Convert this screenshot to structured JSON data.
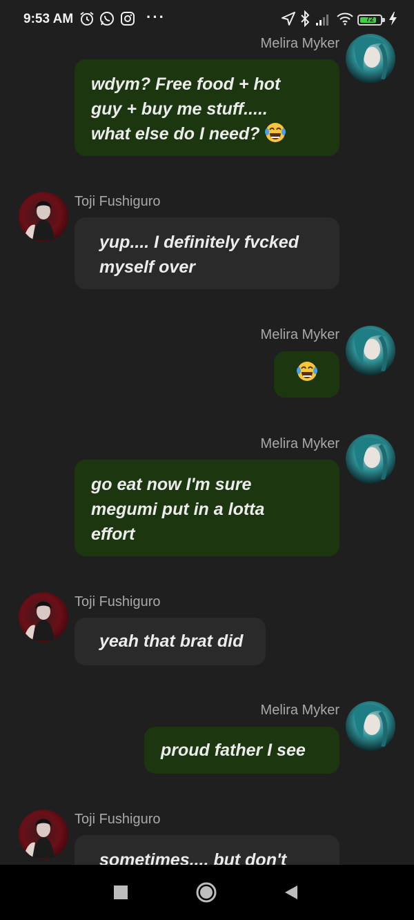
{
  "status_bar": {
    "time": "9:53 AM",
    "icons": [
      "alarm-icon",
      "whatsapp-icon",
      "instagram-icon",
      "more-dots-icon",
      "location-icon",
      "bluetooth-icon",
      "signal-icon",
      "wifi-icon",
      "battery-icon",
      "charging-icon"
    ],
    "more": "···",
    "battery_level": "72"
  },
  "contacts": {
    "me": "Melira Myker",
    "them": "Toji Fushiguro"
  },
  "colors": {
    "my_bubble": "#1c360f",
    "their_bubble": "#2a2a2a",
    "background": "#1f1f1f"
  },
  "messages": [
    {
      "sender": "Melira Myker",
      "text": "wdym? Free food + hot\nguy + buy me stuff.....\nwhat else do I need?",
      "emoji": "laughing-tears"
    },
    {
      "sender": "Toji Fushiguro",
      "text": "yup.... I definitely fvcked\nmyself over"
    },
    {
      "sender": "Melira Myker",
      "text": "",
      "emoji": "laughing-tears"
    },
    {
      "sender": "Melira Myker",
      "text": "go eat now I'm sure\nmegumi put in a lotta\neffort"
    },
    {
      "sender": "Toji Fushiguro",
      "text": "yeah that brat did"
    },
    {
      "sender": "Melira Myker",
      "text": "proud father I see"
    },
    {
      "sender": "Toji Fushiguro",
      "text": "sometimes.... but don't"
    }
  ],
  "nav_bar": [
    "recent-apps-button",
    "home-button",
    "back-button"
  ]
}
